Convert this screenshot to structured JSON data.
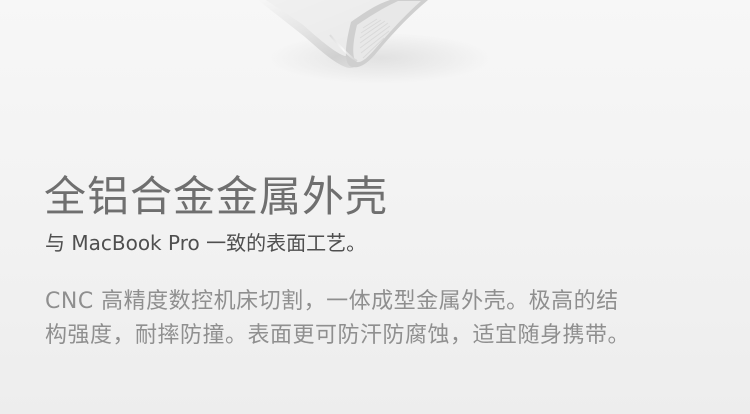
{
  "feature": {
    "title": "全铝合金金属外壳",
    "subtitle": "与 MacBook Pro 一致的表面工艺。",
    "description_lines": [
      "CNC 高精度数控机床切割，一体成型金属外壳。极高的结",
      "构强度，耐摔防撞。表面更可防汗防腐蚀，适宜随身携带。"
    ]
  },
  "colors": {
    "background": "#f3f3f3",
    "title": "#6f6f6f",
    "subtitle": "#4f4f4f",
    "body": "#8f8f8f",
    "metal": "#d7d7d7"
  },
  "image": {
    "subject": "silver aluminium product edge"
  }
}
